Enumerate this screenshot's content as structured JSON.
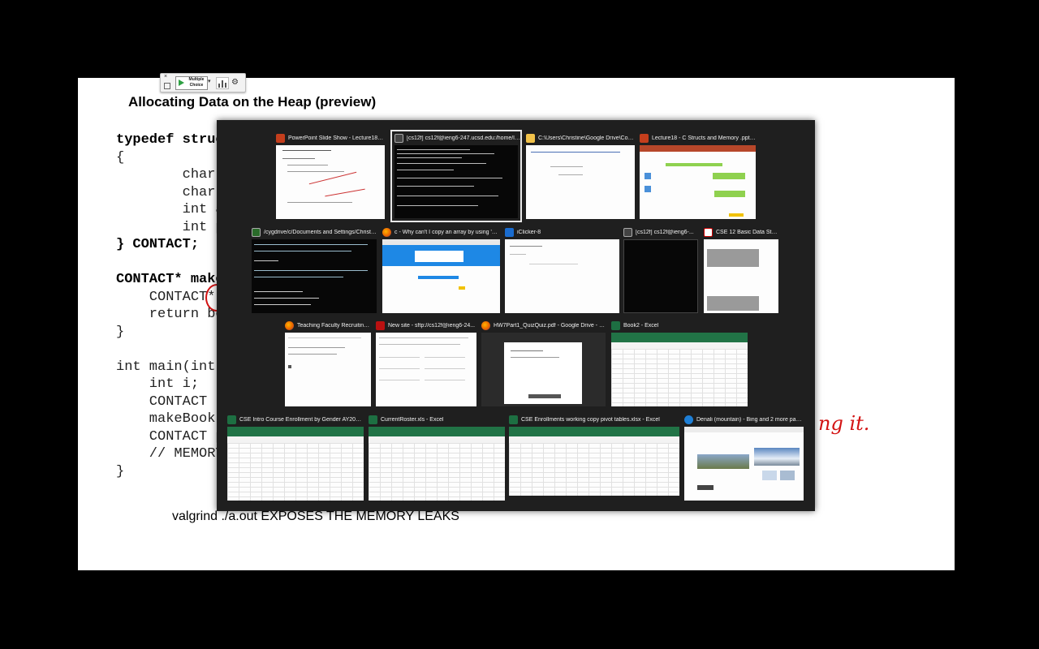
{
  "slide": {
    "title": "Allocating Data on the Heap (preview)",
    "code_lines": [
      "typedef struct",
      "{",
      "        char lastna",
      "        char firstn",
      "        int areaCod",
      "        int phoneNumber;",
      "} CONTACT;",
      "",
      "CONTACT* makeBo",
      "    CONTACT* boo",
      "    return bookptr;",
      "}",
      "",
      "int main(int argc,",
      "    int i;",
      "    CONTACT * phone",
      "    makeBook",
      "    CONTACT p",
      "    // MEMORY",
      "}"
    ],
    "valgrind_text": "valgrind ./a.out  EXPOSES THE MEMORY LEAKS",
    "ink_text": "ng it."
  },
  "clicker_toolbar": {
    "close_glyph": "×",
    "mode_label": "Multiple Choice",
    "caret_glyph": "▾",
    "gear_glyph": "⚙"
  },
  "task_switcher": {
    "windows": [
      {
        "title": "PowerPoint Slide Show - Lecture18 - C...",
        "app": "powerpoint",
        "selected": false
      },
      {
        "title": "[cs12f] cs12f@ieng6-247.ucsd.edu:/home/lin...",
        "app": "terminal",
        "selected": true
      },
      {
        "title": "C:\\Users\\Christine\\Google Drive\\Cour...",
        "app": "explorer",
        "selected": false
      },
      {
        "title": "Lecture18 - C Structs and Memory .pptx -...",
        "app": "powerpoint",
        "selected": false
      },
      {
        "title": "/cygdrive/c/Documents and Settings/Christin...",
        "app": "cygwin",
        "selected": false
      },
      {
        "title": "c - Why can't I copy an array by using '=' ...",
        "app": "firefox",
        "selected": false
      },
      {
        "title": "iClicker-8",
        "app": "iclicker",
        "selected": false
      },
      {
        "title": "[cs12f] cs12f@ieng6-...",
        "app": "terminal",
        "selected": false
      },
      {
        "title": "CSE 12 Basic Data Stru...",
        "app": "pdf",
        "selected": false
      },
      {
        "title": "Teaching Faculty Recruiting...",
        "app": "firefox",
        "selected": false
      },
      {
        "title": "New site - sftp://cs12f@ieng6-24...",
        "app": "filezilla",
        "selected": false
      },
      {
        "title": "HW7Part1_QuizQuiz.pdf - Google Drive - Mo...",
        "app": "firefox",
        "selected": false
      },
      {
        "title": "Book2 - Excel",
        "app": "excel",
        "selected": false
      },
      {
        "title": "CSE Intro Course Enrollment by Gender AY2012-1...",
        "app": "excel",
        "selected": false
      },
      {
        "title": "CurrentRoster.xls - Excel",
        "app": "excel",
        "selected": false
      },
      {
        "title": "CSE Enrollments working copy pivot tables.xlsx - Excel",
        "app": "excel",
        "selected": false
      },
      {
        "title": "Denali (mountain) - Bing and 2 more page...",
        "app": "edge",
        "selected": false
      }
    ]
  },
  "colors": {
    "ink": "#d31313",
    "excel_green": "#217346",
    "switcher_bg": "#1f1f1f",
    "selected_border": "#e8e8e8"
  }
}
